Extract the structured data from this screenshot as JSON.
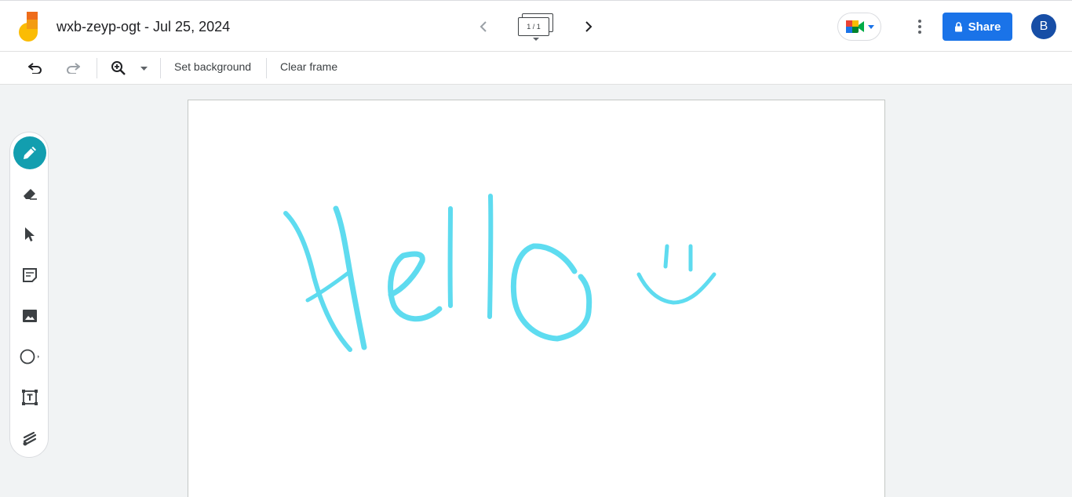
{
  "header": {
    "doc_title": "wxb-zeyp-ogt - Jul 25, 2024",
    "frame_indicator": "1 / 1",
    "share_label": "Share",
    "avatar_initial": "B"
  },
  "toolbar": {
    "set_background_label": "Set background",
    "clear_frame_label": "Clear frame"
  },
  "tools": [
    {
      "name": "pen-icon",
      "active": true
    },
    {
      "name": "eraser-icon",
      "active": false
    },
    {
      "name": "select-icon",
      "active": false
    },
    {
      "name": "sticky-note-icon",
      "active": false
    },
    {
      "name": "image-icon",
      "active": false
    },
    {
      "name": "shape-icon",
      "active": false
    },
    {
      "name": "text-box-icon",
      "active": false
    },
    {
      "name": "laser-icon",
      "active": false
    }
  ],
  "colors": {
    "accent": "#1a73e8",
    "active_tool": "#129eaf",
    "ink": "#4dd8ee",
    "avatar": "#174ea6"
  }
}
